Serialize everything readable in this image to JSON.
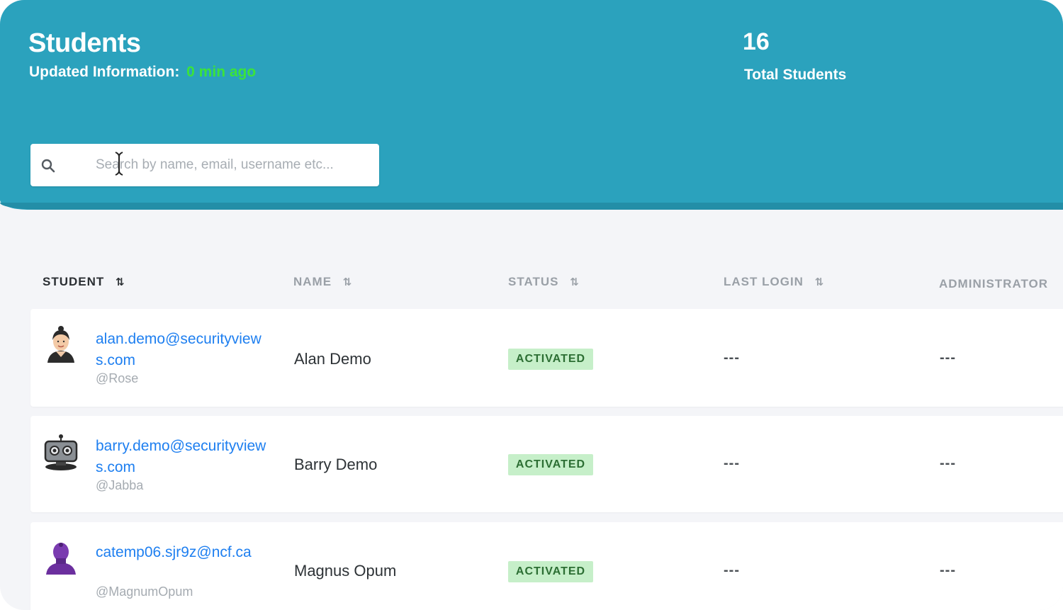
{
  "header": {
    "title": "Students",
    "updated_label": "Updated Information:",
    "updated_value": "0 min ago",
    "total_count": "16",
    "total_label": "Total Students",
    "accent_color": "#2ba2bd",
    "updated_color": "#3be33b"
  },
  "search": {
    "placeholder": "Search by name, email, username etc...",
    "value": "",
    "icon": "search-icon"
  },
  "table": {
    "columns": [
      {
        "label": "STUDENT",
        "sort_icon": "⇅",
        "active": true
      },
      {
        "label": "NAME",
        "sort_icon": "⇅",
        "active": false
      },
      {
        "label": "STATUS",
        "sort_icon": "⇅",
        "active": false
      },
      {
        "label": "LAST LOGIN",
        "sort_icon": "⇅",
        "active": false
      },
      {
        "label": "ADMINISTRATOR",
        "sort_icon": "",
        "active": false
      }
    ],
    "rows": [
      {
        "email": "alan.demo@securityviews.com",
        "username": "@Rose",
        "name": "Alan Demo",
        "status": "ACTIVATED",
        "last_login": "---",
        "administrator": "---",
        "avatar": "person-avatar-icon"
      },
      {
        "email": "barry.demo@securityviews.com",
        "username": "@Jabba",
        "name": "Barry Demo",
        "status": "ACTIVATED",
        "last_login": "---",
        "administrator": "---",
        "avatar": "robot-avatar-icon"
      },
      {
        "email": "catemp06.sjr9z@ncf.ca",
        "username": "@MagnumOpum",
        "name": "Magnus Opum",
        "status": "ACTIVATED",
        "last_login": "---",
        "administrator": "---",
        "avatar": "purple-person-avatar-icon"
      }
    ]
  }
}
